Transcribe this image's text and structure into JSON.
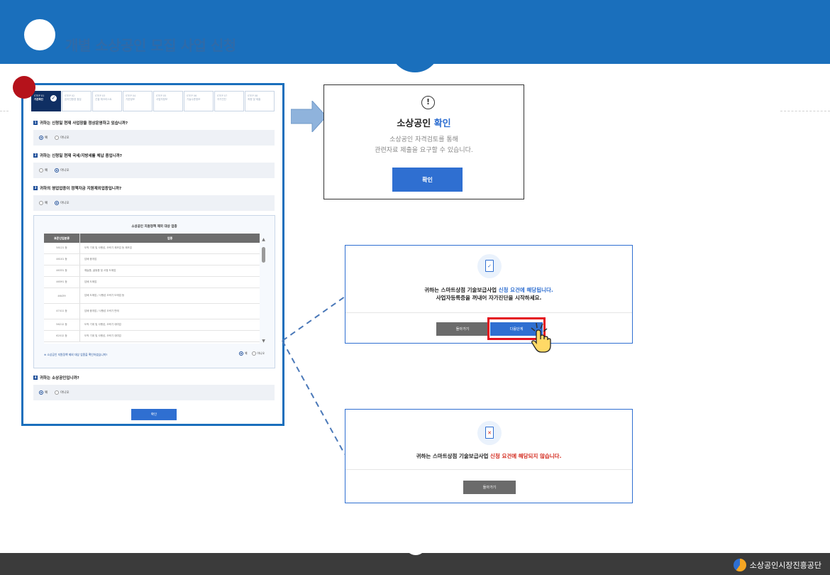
{
  "header": {
    "title": "개별 소상공인 모집 사업 신청"
  },
  "steps": [
    {
      "step": "STEP 01",
      "label": "기본확인",
      "active": true
    },
    {
      "step": "STEP 02",
      "label": "온라인환경 점검",
      "active": false
    },
    {
      "step": "STEP 03",
      "label": "선결 체크리스트",
      "active": false
    },
    {
      "step": "STEP 04",
      "label": "기본정보",
      "active": false
    },
    {
      "step": "STEP 05",
      "label": "사업자정보",
      "active": false
    },
    {
      "step": "STEP 06",
      "label": "기술수준정보",
      "active": false
    },
    {
      "step": "STEP 07",
      "label": "자가진단",
      "active": false
    },
    {
      "step": "STEP 08",
      "label": "최종 및 제출",
      "active": false
    }
  ],
  "questions": [
    {
      "num": "1",
      "text": "귀하는 신청일 현재 사업장을 정상운영하고 있습니까?",
      "yes": "예",
      "no": "아니오",
      "selected": "yes"
    },
    {
      "num": "2",
      "text": "귀하는 신청일 현재 국세/지방세를 체납 중입니까?",
      "yes": "예",
      "no": "아니오",
      "selected": "no"
    },
    {
      "num": "3",
      "text": "귀하의 영업업종이 정책자금 지원제외업종입니까?",
      "yes": "예",
      "no": "아니오",
      "selected": "no"
    },
    {
      "num": "4",
      "text": "귀하는 소상공인입니까?",
      "yes": "예",
      "no": "아니오",
      "selected": "yes"
    }
  ],
  "exclusion_list": {
    "title": "소상공인 지원정책 제외 대상 업종",
    "headers": [
      "표준산업분류",
      "업종"
    ],
    "rows": [
      {
        "code": "58121 등",
        "desc": "도박 기계 및 사행성, 오락기 제조업 등 제조업"
      },
      {
        "code": "46101 등",
        "desc": "담배 중개업"
      },
      {
        "code": "46331 등",
        "desc": "예술품, 골동품 및 서점 도매업"
      },
      {
        "code": "46591 등",
        "desc": "담배 도매업"
      },
      {
        "code": "46439",
        "desc": "담배 도매업 / 사행성 오락기 도매업 등"
      },
      {
        "code": "47411 등",
        "desc": "담배 중개업 / 사행성 오락기 판매"
      },
      {
        "code": "56212 등",
        "desc": "도박 기계 및 사행성, 오락기 대여업"
      },
      {
        "code": "62012 등",
        "desc": "도박 기계 및 사행성, 오락기 대여업"
      }
    ],
    "question": "※ 소상공인 지원정책 제외 대상 업종을 확인하셨습니까?",
    "yes": "예",
    "no": "아니오"
  },
  "submit_label": "확인",
  "confirm_modal": {
    "icon": "!",
    "title_prefix": "소상공인",
    "title_highlight": "확인",
    "line1": "소상공인 자격검토를 통해",
    "line2": "관련자료 제출을 요구할 수 있습니다.",
    "button": "확인"
  },
  "eligible_modal": {
    "prefix": "귀하는 스마트상점 기술보급사업",
    "highlight": "신청 요건에 해당됩니다.",
    "line2": "사업자등록증을 꺼내어 자가진단을 시작하세요.",
    "back": "돌아가기",
    "next": "다음단계"
  },
  "ineligible_modal": {
    "prefix": "귀하는 스마트상점 기술보급사업",
    "highlight": "신청 요건에 해당되지 않습니다.",
    "back": "돌아가기"
  },
  "footer": {
    "org": "소상공인시장진흥공단"
  },
  "colors": {
    "brand": "#1a6fbc",
    "accent": "#2f6fd1",
    "alert": "#d3291d",
    "highlight_box": "#e4101d"
  }
}
